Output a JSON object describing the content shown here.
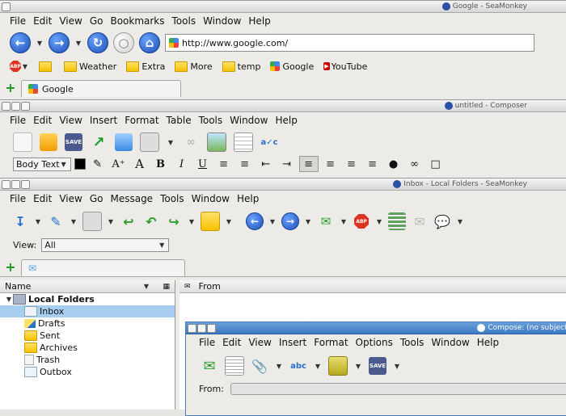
{
  "browser": {
    "title": "Google - SeaMonkey",
    "menu": [
      "File",
      "Edit",
      "View",
      "Go",
      "Bookmarks",
      "Tools",
      "Window",
      "Help"
    ],
    "url": "http://www.google.com/",
    "bookmarks": [
      {
        "label": "",
        "icon": "folder-icon"
      },
      {
        "label": "Weather",
        "icon": "folder-icon"
      },
      {
        "label": "Extra",
        "icon": "folder-icon"
      },
      {
        "label": "More",
        "icon": "folder-icon"
      },
      {
        "label": "temp",
        "icon": "folder-icon"
      },
      {
        "label": "Google",
        "icon": "google-icon"
      },
      {
        "label": "YouTube",
        "icon": "youtube-icon"
      }
    ],
    "abp_label": "ABP",
    "tab_label": "Google"
  },
  "composer": {
    "title": "untitled - Composer",
    "menu": [
      "File",
      "Edit",
      "View",
      "Insert",
      "Format",
      "Table",
      "Tools",
      "Window",
      "Help"
    ],
    "paragraph_style": "Body Text"
  },
  "mail": {
    "title": "Inbox - Local Folders - SeaMonkey",
    "menu": [
      "File",
      "Edit",
      "View",
      "Go",
      "Message",
      "Tools",
      "Window",
      "Help"
    ],
    "view_label": "View:",
    "view_value": "All",
    "folder_column": "Name",
    "from_column": "From",
    "root_folder": "Local Folders",
    "folders": [
      "Inbox",
      "Drafts",
      "Sent",
      "Archives",
      "Trash",
      "Outbox"
    ],
    "abp_label": "ABP"
  },
  "compose": {
    "title": "Compose: (no subject)",
    "menu": [
      "File",
      "Edit",
      "View",
      "Insert",
      "Format",
      "Options",
      "Tools",
      "Window",
      "Help"
    ],
    "from_label": "From:",
    "spell_label": "abc"
  },
  "colors": {
    "selection": "#a7cdf0",
    "accent": "#1b4fb5",
    "compose_title": "#3d78c4"
  }
}
